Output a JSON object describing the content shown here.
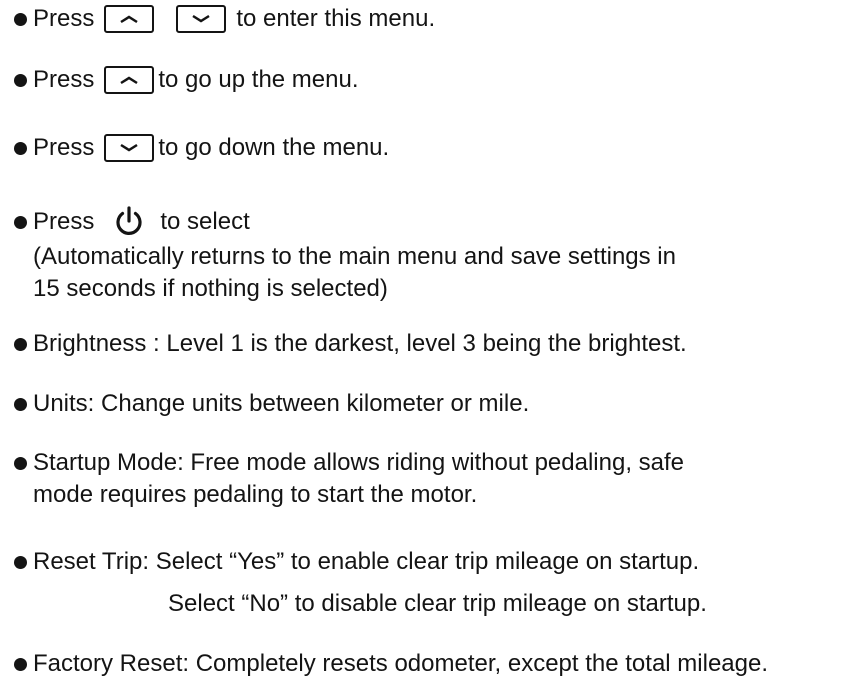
{
  "items": [
    {
      "prefix": "Press",
      "suffix": "to enter this menu."
    },
    {
      "prefix": "Press",
      "suffix": "to go up the menu."
    },
    {
      "prefix": "Press",
      "suffix": "to go down the menu."
    },
    {
      "prefix": "Press",
      "suffix": "to select",
      "note_line1": "(Automatically returns to the main menu and  save settings in",
      "note_line2": "15 seconds if nothing is selected)"
    },
    {
      "text": "Brightness : Level 1 is the darkest, level 3 being the brightest."
    },
    {
      "text": "Units: Change units between kilometer or mile."
    },
    {
      "text": "Startup Mode: Free mode allows riding without pedaling, safe",
      "text2": "mode requires pedaling to start the motor."
    },
    {
      "text": "Reset Trip: Select “Yes” to enable clear trip mileage on startup.",
      "text2": "Select “No” to disable clear trip mileage on startup."
    },
    {
      "text": "Factory Reset: Completely resets odometer, except the total mileage."
    }
  ],
  "icons": {
    "up": "chevron-up-icon",
    "down": "chevron-down-icon",
    "power": "power-icon"
  }
}
